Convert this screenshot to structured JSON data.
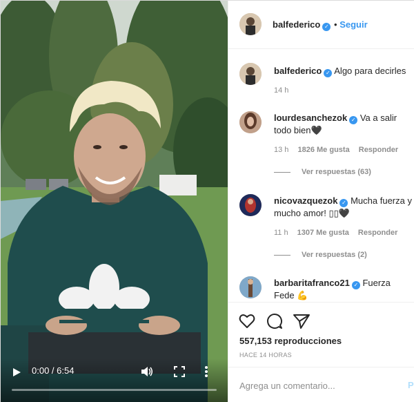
{
  "video": {
    "time": "0:00 / 6:54",
    "progress": 0.0,
    "icons": {
      "play": "play-icon",
      "volume": "volume-icon",
      "fullscreen": "fullscreen-icon",
      "more": "more-vertical-icon"
    }
  },
  "header": {
    "username": "balfederico",
    "separator": "•",
    "follow_label": "Seguir"
  },
  "caption": {
    "username": "balfederico",
    "text": "Algo para decirles",
    "time": "14 h"
  },
  "comments": [
    {
      "username": "lourdesanchezok",
      "text": "Va a salir todo bien🖤",
      "time": "13 h",
      "likes": "1826 Me gusta",
      "reply": "Responder",
      "view_replies": "Ver respuestas (63)"
    },
    {
      "username": "nicovazquezok",
      "text": "Mucha fuerza y mucho amor! ▯▯🖤",
      "time": "11 h",
      "likes": "1307 Me gusta",
      "reply": "Responder",
      "view_replies": "Ver respuestas (2)"
    },
    {
      "username": "barbaritafranco21",
      "text": "Fuerza Fede 💪",
      "time": "",
      "likes": "",
      "reply": "",
      "view_replies": ""
    }
  ],
  "actions": {
    "icons": [
      "heart-icon",
      "comment-icon",
      "share-icon"
    ],
    "views": "557,153 reproducciones",
    "posted": "HACE 14 HORAS"
  },
  "add_comment": {
    "placeholder": "Agrega un comentario...",
    "post_label": "Pu"
  },
  "colors": {
    "accent": "#3897f0",
    "text": "#262626",
    "muted": "#8e8e8e",
    "border": "#efefef"
  }
}
